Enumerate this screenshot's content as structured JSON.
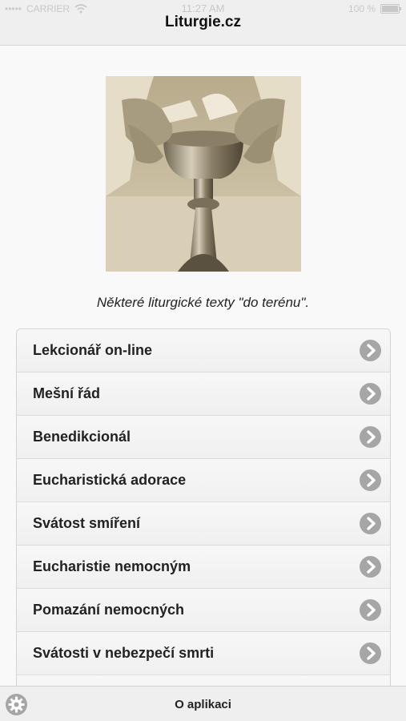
{
  "status_bar": {
    "signal": "•••••",
    "carrier": "CARRIER",
    "time": "11:27 AM",
    "battery": "100 %"
  },
  "header": {
    "title": "Liturgie.cz"
  },
  "main": {
    "tagline": "Některé liturgické texty \"do terénu\".",
    "menu": [
      {
        "label": "Lekcionář on-line"
      },
      {
        "label": "Mešní řád"
      },
      {
        "label": "Benedikcionál"
      },
      {
        "label": "Eucharistická adorace"
      },
      {
        "label": "Svátost smíření"
      },
      {
        "label": "Eucharistie nemocným"
      },
      {
        "label": "Pomazání nemocných"
      },
      {
        "label": "Svátosti v nebezpečí smrti"
      }
    ]
  },
  "footer": {
    "label": "O aplikaci"
  },
  "colors": {
    "header_bg": "#efefef",
    "chevron_bg": "#a6a6a6",
    "sepia": "#c9bd9f"
  }
}
